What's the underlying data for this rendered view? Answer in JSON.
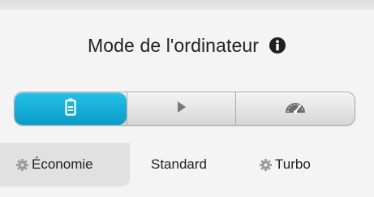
{
  "header": {
    "title": "Mode de l'ordinateur",
    "info_icon": "info-icon"
  },
  "mode_switcher": {
    "selected": "Économie",
    "accent_color": "#12aad6",
    "segments": [
      {
        "icon": "battery-icon",
        "active": true
      },
      {
        "icon": "play-icon",
        "active": false
      },
      {
        "icon": "speedometer-icon",
        "active": false
      }
    ]
  },
  "modes": [
    {
      "label": "Économie",
      "icon": "gear-icon"
    },
    {
      "label": "Standard"
    },
    {
      "label": "Turbo",
      "icon": "gear-icon"
    }
  ]
}
